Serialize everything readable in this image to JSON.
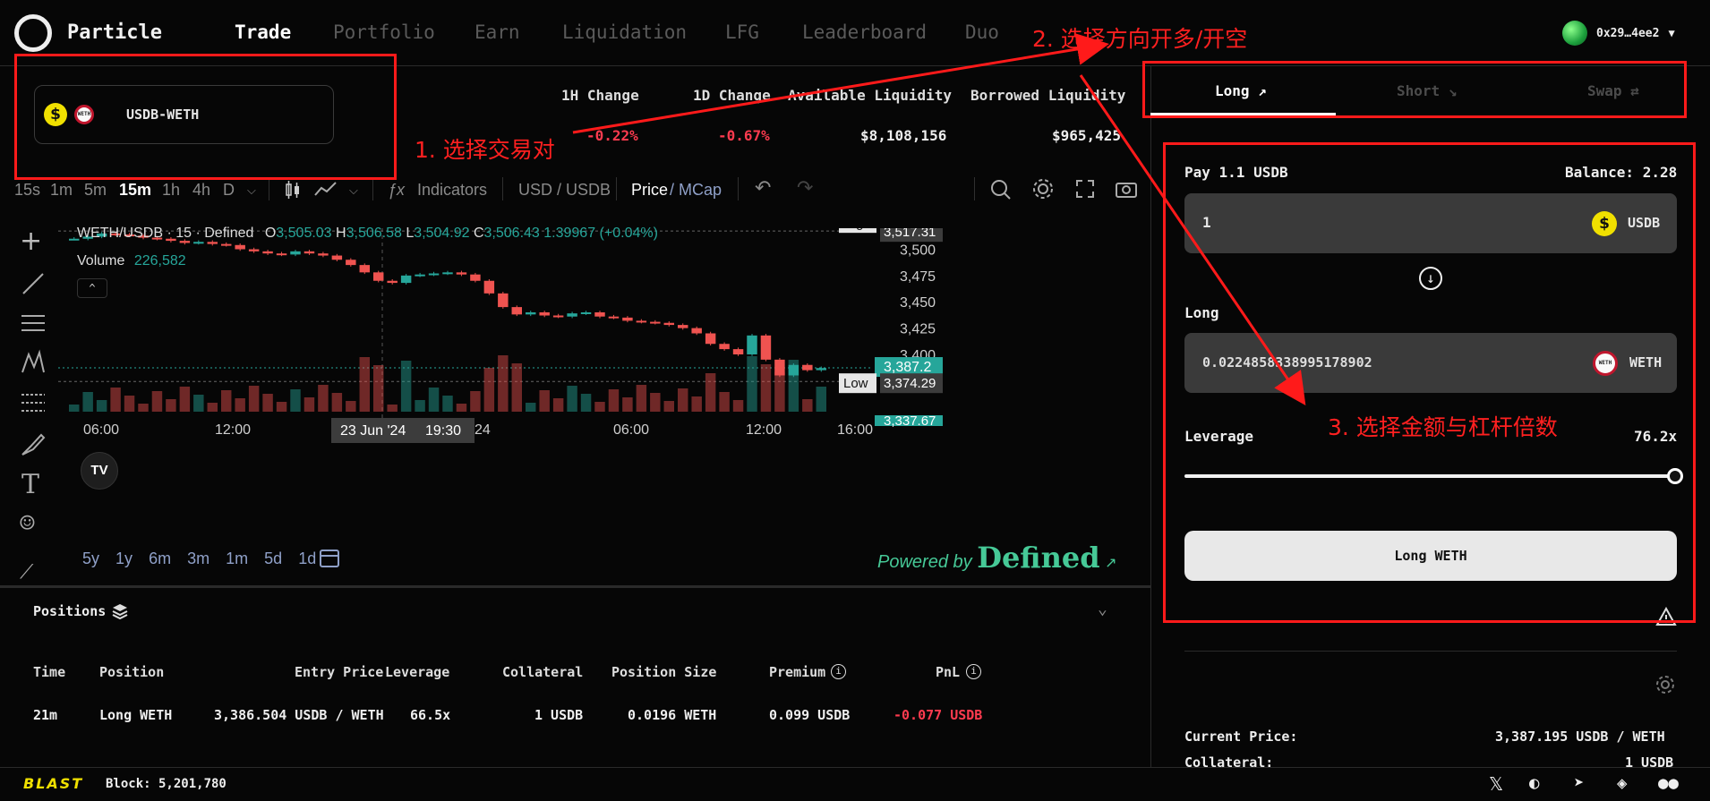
{
  "nav": {
    "brand": "Particle",
    "items": [
      "Trade",
      "Portfolio",
      "Earn",
      "Liquidation",
      "LFG",
      "Leaderboard",
      "Duo"
    ],
    "active": "Trade",
    "wallet": "0x29…4ee2"
  },
  "pair": {
    "label": "USDB-WETH"
  },
  "stats": {
    "labels": [
      "1H Change",
      "1D Change",
      "Available Liquidity",
      "Borrowed Liquidity"
    ],
    "values": [
      "-0.22%",
      "-0.67%",
      "$8,108,156",
      "$965,425"
    ]
  },
  "toolbar": {
    "intervals": [
      "15s",
      "1m",
      "5m",
      "15m",
      "1h",
      "4h",
      "D"
    ],
    "active_interval": "15m",
    "indicators": "Indicators",
    "currency": "USD / USDB",
    "price_label": "Price",
    "mcap_label": "/ MCap"
  },
  "chart": {
    "symbol": "WETH/USDB · 15 · Defined",
    "o_key": "O",
    "o": "3,505.03",
    "h_key": "H",
    "h": "3,506.58",
    "l_key": "L",
    "l": "3,504.92",
    "c_key": "C",
    "c": "3,506.43",
    "change": "1.39967 (+0.04%)",
    "volume_label": "Volume",
    "volume": "226,582",
    "high_label": "High",
    "high_price": "3,517.31",
    "low_label": "Low",
    "low_price": "3,374.29",
    "last_price": "3,387.2",
    "bottom_price": "3,337.67",
    "y_ticks": [
      "3,500",
      "3,475",
      "3,450",
      "3,425",
      "3,400"
    ],
    "x_ticks": [
      "06:00",
      "12:00",
      "24",
      "06:00",
      "12:00",
      "16:00"
    ],
    "crosshair_date": "23 Jun '24",
    "crosshair_time": "19:30",
    "ranges": [
      "5y",
      "1y",
      "6m",
      "3m",
      "1m",
      "5d",
      "1d"
    ],
    "powered_by": "Powered by",
    "powered_brand": "Defined",
    "colors": {
      "up": "#26a69a",
      "down": "#ef5350"
    }
  },
  "chart_data": {
    "type": "candlestick",
    "title": "WETH/USDB · 15 · Defined",
    "ylim": [
      3337,
      3520
    ],
    "closes_approx": [
      3510,
      3512,
      3515,
      3514,
      3513,
      3511,
      3510,
      3508,
      3506,
      3507,
      3505,
      3504,
      3500,
      3498,
      3496,
      3495,
      3498,
      3496,
      3494,
      3490,
      3485,
      3478,
      3470,
      3468,
      3475,
      3476,
      3477,
      3478,
      3476,
      3470,
      3458,
      3445,
      3438,
      3440,
      3437,
      3436,
      3439,
      3440,
      3436,
      3435,
      3432,
      3431,
      3430,
      3428,
      3425,
      3420,
      3410,
      3405,
      3400,
      3418,
      3395,
      3380,
      3390,
      3385,
      3387
    ],
    "high": 3517.31,
    "low": 3374.29,
    "last": 3387.2
  },
  "positions": {
    "title": "Positions",
    "headers": [
      "Time",
      "Position",
      "Entry Price",
      "Leverage",
      "Collateral",
      "Position Size",
      "Premium",
      "PnL"
    ],
    "row": [
      "21m",
      "Long WETH",
      "3,386.504 USDB / WETH",
      "66.5x",
      "1 USDB",
      "0.0196 WETH",
      "0.099 USDB",
      "-0.077 USDB"
    ]
  },
  "panel": {
    "tabs": [
      "Long",
      "Short",
      "Swap"
    ],
    "pay_label": "Pay 1.1 USDB",
    "balance": "Balance: 2.28",
    "pay_value": "1",
    "pay_token": "USDB",
    "long_label": "Long",
    "long_value": "0.0224858338995178902",
    "long_token": "WETH",
    "leverage_label": "Leverage",
    "leverage_value": "76.2x",
    "leverage_fraction": 1.0,
    "button": "Long WETH",
    "current_price_label": "Current Price:",
    "current_price": "3,387.195 USDB / WETH",
    "collateral_label": "Collateral:",
    "collateral": "1 USDB"
  },
  "footer": {
    "brand": "BLAST",
    "block": "Block: 5,201,780"
  },
  "annotations": [
    "1. 选择交易对",
    "2. 选择方向开多/开空",
    "3. 选择金额与杠杆倍数"
  ]
}
